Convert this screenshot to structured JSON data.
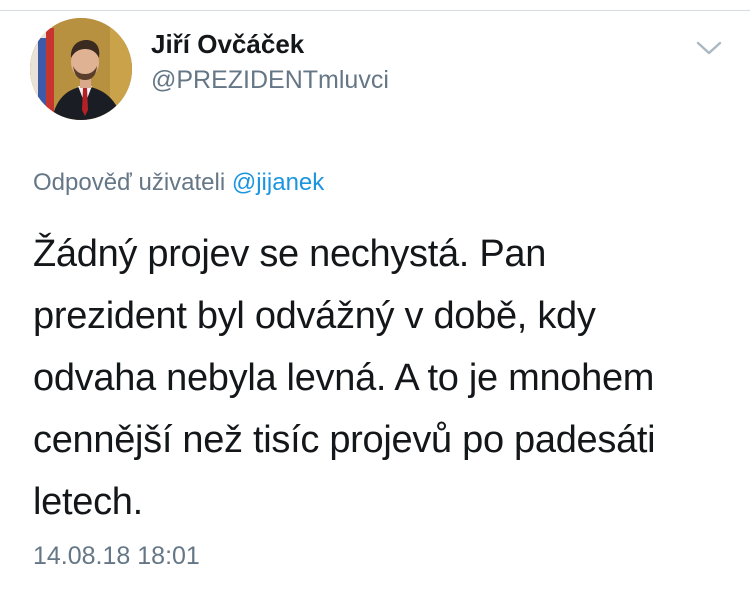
{
  "tweet": {
    "author": {
      "display_name": "Jiří Ovčáček",
      "handle": "@PREZIDENTmluvci"
    },
    "reply_prefix": "Odpověď uživateli ",
    "reply_mention": "@jijanek",
    "text": "Žádný projev se nechystá. Pan\nprezident byl odvážný v době, kdy\nodvaha nebyla levná. A to je mnohem\ncennější než tisíc projevů po padesáti\nletech.",
    "timestamp": "14.08.18 18:01"
  },
  "icons": {
    "menu": "chevron-down-icon",
    "avatar": "profile-photo"
  },
  "colors": {
    "text_primary": "#14171a",
    "text_secondary": "#657786",
    "link": "#1b95e0",
    "divider": "#d5dbe0"
  }
}
